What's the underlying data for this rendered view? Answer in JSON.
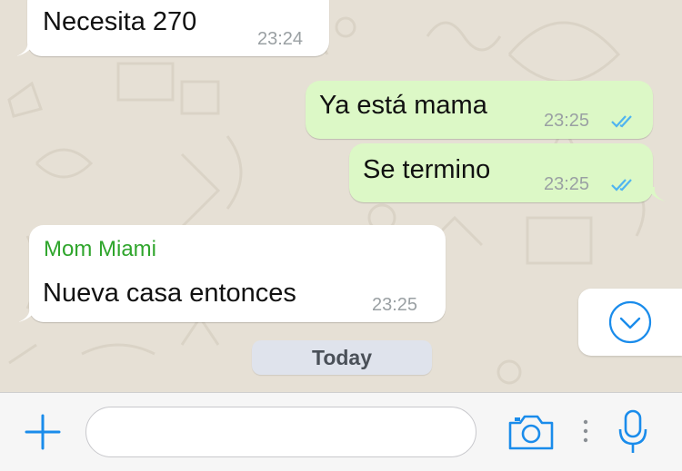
{
  "messages": [
    {
      "direction": "incoming",
      "text": "Necesita 270",
      "time": "23:24"
    },
    {
      "direction": "outgoing",
      "text": "Ya está mama",
      "time": "23:25",
      "status": "read"
    },
    {
      "direction": "outgoing",
      "text": "Se termino",
      "time": "23:25",
      "status": "read"
    },
    {
      "direction": "incoming",
      "sender": "Mom Miami",
      "text": "Nueva casa entonces",
      "time": "23:25"
    }
  ],
  "date_divider": "Today",
  "icons": {
    "add": "plus-icon",
    "camera": "camera-icon",
    "mic": "microphone-icon",
    "scroll_down": "chevron-down-icon",
    "read_receipt": "double-check-icon"
  },
  "colors": {
    "incoming_bubble": "#ffffff",
    "outgoing_bubble": "#dcf8c6",
    "sender_name": "#2fa52c",
    "accent_blue": "#1a8ceb",
    "read_ticks": "#4fb4f0"
  }
}
